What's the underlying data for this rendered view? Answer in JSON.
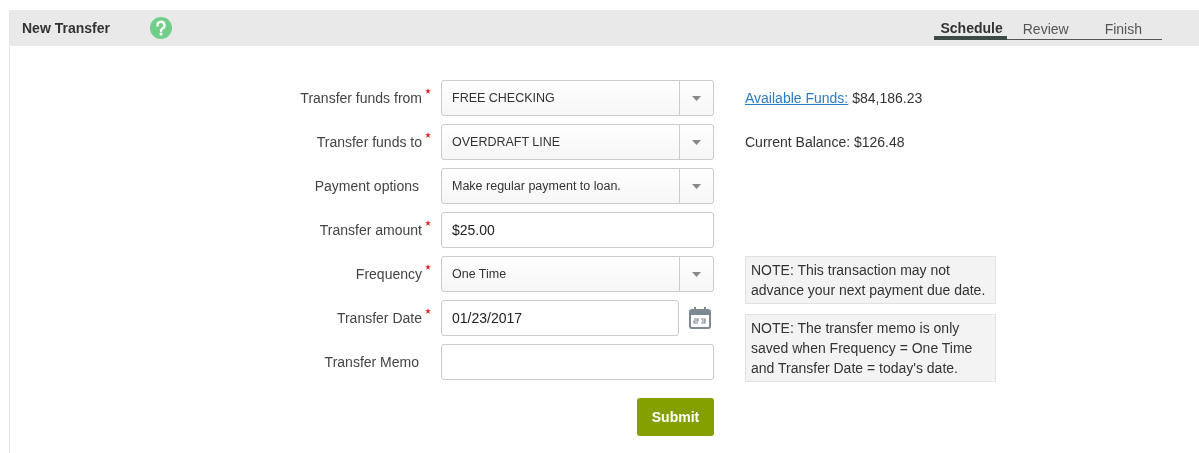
{
  "header": {
    "title": "New Transfer"
  },
  "tabs": [
    {
      "label": "Schedule",
      "selected": true
    },
    {
      "label": "Review",
      "selected": false
    },
    {
      "label": "Finish",
      "selected": false
    }
  ],
  "fields": [
    {
      "kind": "select",
      "label": "Transfer funds from",
      "required": true,
      "value": "FREE CHECKING"
    },
    {
      "kind": "select",
      "label": "Transfer funds to",
      "required": true,
      "value": "OVERDRAFT LINE"
    },
    {
      "kind": "select",
      "label": "Payment options",
      "required": false,
      "value": "Make regular payment to loan."
    },
    {
      "kind": "text",
      "label": "Transfer amount",
      "required": true,
      "value": "$25.00"
    },
    {
      "kind": "select",
      "label": "Frequency",
      "required": true,
      "value": "One Time"
    },
    {
      "kind": "date",
      "label": "Transfer Date",
      "required": true,
      "value": "01/23/2017"
    },
    {
      "kind": "text",
      "label": "Transfer Memo",
      "required": false
    }
  ],
  "info": [
    {
      "link": "Available Funds:",
      "value": "$84,186.23"
    },
    {
      "text": "Current Balance: $126.48"
    }
  ],
  "notes": [
    "NOTE: This transaction may not advance your next payment due date.",
    "NOTE: The transfer memo is only saved when Frequency = One Time and Transfer Date = today's date."
  ],
  "submit": "Submit"
}
